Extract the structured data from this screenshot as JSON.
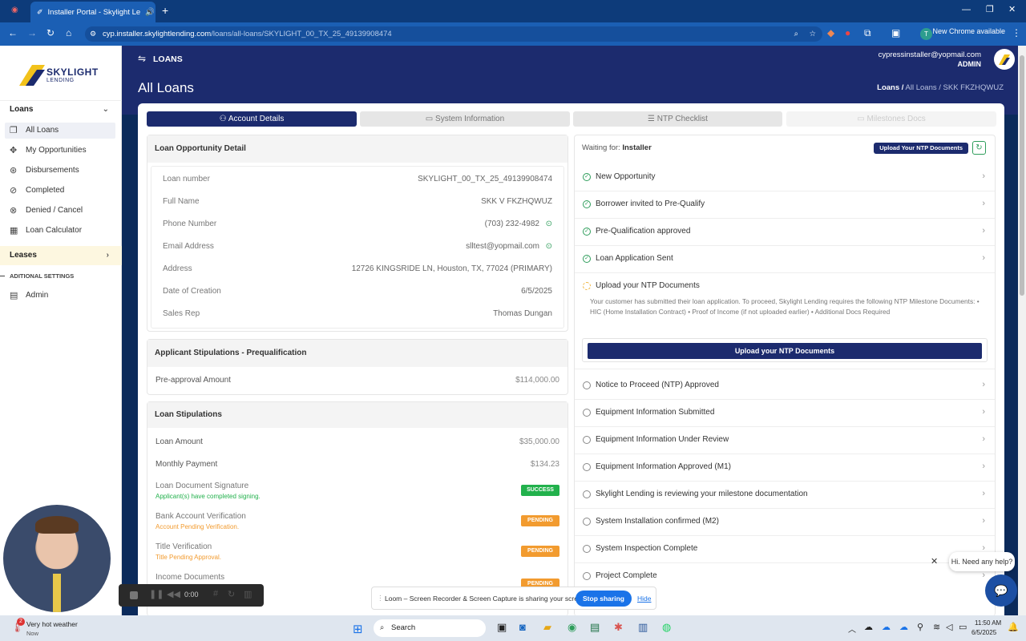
{
  "browser": {
    "tab_title": "Installer Portal - Skylight Le",
    "url_host": "cyp.installer.skylightlending.com",
    "url_path": "/loans/all-loans/SKYLIGHT_00_TX_25_49139908474",
    "new_chrome": "New Chrome available",
    "profile_initial": "T"
  },
  "sidebar": {
    "logo_brand": "SKYLIGHT",
    "logo_sub": "LENDING",
    "loans_group": "Loans",
    "loans_items": [
      "All Loans",
      "My Opportunities",
      "Disbursements",
      "Completed",
      "Denied / Cancel",
      "Loan Calculator"
    ],
    "leases_group": "Leases",
    "settings_group": "ADITIONAL SETTINGS",
    "admin_item": "Admin"
  },
  "topnav": {
    "section": "LOANS",
    "user_email": "cypressinstaller@yopmail.com",
    "user_role": "ADMIN"
  },
  "page": {
    "title": "All Loans",
    "breadcrumb_root": "Loans /",
    "breadcrumb_rest": " All Loans / SKK FKZHQWUZ"
  },
  "tabs": [
    "Account Details",
    "System Information",
    "NTP Checklist",
    "Milestones Docs"
  ],
  "loan_detail": {
    "heading": "Loan Opportunity Detail",
    "rows": [
      {
        "k": "Loan number",
        "v": "SKYLIGHT_00_TX_25_49139908474"
      },
      {
        "k": "Full Name",
        "v": "SKK V FKZHQWUZ"
      },
      {
        "k": "Phone Number",
        "v": "(703) 232-4982"
      },
      {
        "k": "Email Address",
        "v": "slltest@yopmail.com"
      },
      {
        "k": "Address",
        "v": "12726 KINGSRIDE LN, Houston, TX, 77024 (PRIMARY)"
      },
      {
        "k": "Date of Creation",
        "v": "6/5/2025"
      },
      {
        "k": "Sales Rep",
        "v": "Thomas Dungan"
      }
    ]
  },
  "applicant": {
    "heading": "Applicant Stipulations - Prequalification",
    "k": "Pre-approval Amount",
    "v": "$114,000.00"
  },
  "loan_stips": {
    "heading": "Loan Stipulations",
    "loan_amount_k": "Loan Amount",
    "loan_amount_v": "$35,000.00",
    "monthly_k": "Monthly Payment",
    "monthly_v": "$134.23",
    "items": [
      {
        "k": "Loan Document Signature",
        "s": "Applicant(s) have completed signing.",
        "badge": "SUCCESS"
      },
      {
        "k": "Bank Account Verification",
        "s": "Account Pending Verification.",
        "badge": "PENDING"
      },
      {
        "k": "Title Verification",
        "s": "Title Pending Approval.",
        "badge": "PENDING"
      },
      {
        "k": "Income Documents",
        "s": "",
        "badge": "PENDING"
      }
    ],
    "success_color": "#22b14c",
    "pending_color": "#f29b2f"
  },
  "milestones": {
    "waiting_label": "Waiting for:",
    "waiting_value": "Installer",
    "upload_btn": "Upload Your NTP Documents",
    "done": [
      "New Opportunity",
      "Borrower invited to Pre-Qualify",
      "Pre-Qualification approved",
      "Loan Application Sent"
    ],
    "current_title": "Upload your NTP Documents",
    "current_desc": "Your customer has submitted their loan application. To proceed, Skylight Lending requires the following NTP Milestone Documents: • HIC (Home Installation Contract) • Proof of Income (if not uploaded earlier) • Additional Docs Required",
    "current_btn": "Upload your NTP Documents",
    "pending": [
      "Notice to Proceed (NTP) Approved",
      "Equipment Information Submitted",
      "Equipment Information Under Review",
      "Equipment Information Approved (M1)",
      "Skylight Lending is reviewing your milestone documentation",
      "System Installation confirmed (M2)",
      "System Inspection Complete",
      "Project Complete"
    ]
  },
  "overlays": {
    "loom_time": "0:00",
    "share_msg": "Loom – Screen Recorder & Screen Capture is sharing your screen.",
    "stop_sharing": "Stop sharing",
    "hide": "Hide",
    "help": "Hi. Need any help?"
  },
  "taskbar": {
    "weather_badge": "2",
    "weather": "Very hot weather",
    "weather_sub": "Now",
    "search": "Search",
    "time": "11:50 AM",
    "date": "6/5/2025"
  },
  "colors": {
    "navy": "#1c2b6e",
    "accent_green": "#2e9d5b"
  }
}
